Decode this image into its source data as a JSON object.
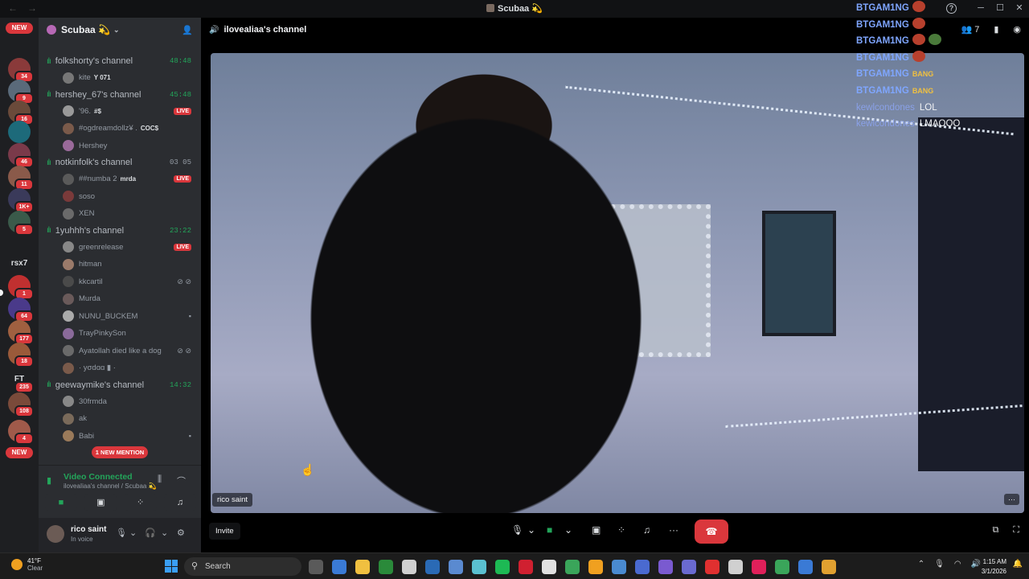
{
  "window": {
    "title": "Scubaa 💫",
    "help": "?"
  },
  "rail": {
    "new_top": "NEW",
    "new_bottom": "NEW",
    "servers": [
      {
        "badge": "34",
        "color": "#8a3a3a"
      },
      {
        "badge": "9",
        "color": "#5a6a7a"
      },
      {
        "badge": "16",
        "color": "#6a4a3a"
      },
      {
        "badge": "",
        "color": "#1d6a7a"
      },
      {
        "badge": "46",
        "color": "#7a3a4a"
      },
      {
        "badge": "11",
        "color": "#8a5a4a"
      },
      {
        "badge": "1K+",
        "color": "#3a3a5a"
      },
      {
        "badge": "5",
        "color": "#3a5a4a"
      },
      {
        "badge": "",
        "color": "",
        "text": "rsx7"
      },
      {
        "badge": "1",
        "color": "#c03030"
      },
      {
        "badge": "64",
        "color": "#4a3a8a"
      },
      {
        "badge": "177",
        "color": "#a06040"
      },
      {
        "badge": "18",
        "color": "#9a5a3a"
      },
      {
        "badge": "235",
        "color": "",
        "text": "FT"
      },
      {
        "badge": "108",
        "color": "#7a4a3a"
      },
      {
        "badge": "4",
        "color": "#a05a4a"
      }
    ]
  },
  "sidebar": {
    "guild_name": "Scubaa 💫",
    "channels": [
      {
        "name": "folkshorty's channel",
        "time": "48:48",
        "time_style": "green",
        "members": [
          {
            "name": "kite",
            "tag": "Y 071",
            "live": false,
            "icon": "",
            "color": "#777"
          }
        ]
      },
      {
        "name": "hershey_67's channel",
        "time": "45:48",
        "time_style": "green",
        "members": [
          {
            "name": "'96.",
            "tag": "#$",
            "live": true,
            "icon": "",
            "color": "#999"
          },
          {
            "name": "#ogdreamdollz¥ .",
            "tag": "COC$",
            "live": false,
            "icon": "",
            "color": "#7a5a4a"
          },
          {
            "name": "Hershey",
            "tag": "",
            "live": false,
            "icon": "",
            "color": "#9a6a9a"
          }
        ]
      },
      {
        "name": "notkinfolk's channel",
        "time": "03 05",
        "time_style": "grey",
        "members": [
          {
            "name": "##numba 2",
            "tag": "mrda",
            "live": true,
            "icon": "",
            "color": "#5a5a5a"
          },
          {
            "name": "soso",
            "tag": "",
            "live": false,
            "icon": "",
            "color": "#7a3a3a"
          },
          {
            "name": "XEN",
            "tag": "",
            "live": false,
            "icon": "",
            "color": "#6a6a6a"
          }
        ]
      },
      {
        "name": "1yuhhh's channel",
        "time": "23:22",
        "time_style": "green",
        "members": [
          {
            "name": "greenrelease",
            "tag": "",
            "live": true,
            "icon": "",
            "color": "#888"
          },
          {
            "name": "hitman",
            "tag": "",
            "live": false,
            "icon": "",
            "color": "#9a7a6a"
          },
          {
            "name": "kkcartil",
            "tag": "",
            "live": false,
            "icon": "⊘ ⊘",
            "color": "#4a4a4a"
          },
          {
            "name": "Murda",
            "tag": "",
            "live": false,
            "icon": "",
            "color": "#6a5a5a"
          },
          {
            "name": "NUNU_BUCKEM",
            "tag": "",
            "live": false,
            "icon": "▪",
            "color": "#aaa"
          },
          {
            "name": "TrayPinkySon",
            "tag": "",
            "live": false,
            "icon": "",
            "color": "#8a6a9a"
          },
          {
            "name": "Ayatollah died like a dog",
            "tag": "",
            "live": false,
            "icon": "⊘ ⊘",
            "color": "#6a6a6a"
          },
          {
            "name": "· yσdɑɑ ▮ ·",
            "tag": "",
            "live": false,
            "icon": "",
            "color": "#7a5a4a"
          }
        ]
      },
      {
        "name": "geewaymike's channel",
        "time": "14:32",
        "time_style": "green",
        "members": [
          {
            "name": "30frmda",
            "tag": "",
            "live": false,
            "icon": "",
            "color": "#888"
          },
          {
            "name": "ak",
            "tag": "",
            "live": false,
            "icon": "",
            "color": "#7a6a5a"
          },
          {
            "name": "Babi",
            "tag": "",
            "live": false,
            "icon": "▪",
            "color": "#9a7a5a"
          }
        ]
      }
    ],
    "mention_pill": "1 NEW MENTION",
    "voice": {
      "status": "Video Connected",
      "location": "iloveaIiaa's channel / Scubaa 💫"
    },
    "user": {
      "name": "rico saint",
      "status": "In voice"
    }
  },
  "main": {
    "channel_name": "iloveaIiaa's channel",
    "viewer_count": "7",
    "stream_name": "rico saint",
    "invite_label": "Invite"
  },
  "chat": [
    {
      "user": "BTGAM1NG",
      "msg": "",
      "emote": "tomato"
    },
    {
      "user": "BTGAM1NG",
      "msg": "",
      "emote": "tomato"
    },
    {
      "user": "BTGAM1NG",
      "msg": "",
      "emote": "tomato-double"
    },
    {
      "user": "BTGAM1NG",
      "msg": "",
      "emote": "tomato"
    },
    {
      "user": "BTGAM1NG",
      "msg": "",
      "emote": "BANG"
    },
    {
      "user": "BTGAM1NG",
      "msg": "",
      "emote": "BANG"
    },
    {
      "user": "kewlcondones",
      "msg": "LOL",
      "emote": ""
    },
    {
      "user": "kewlcondones",
      "msg": "LMAOOO",
      "emote": ""
    }
  ],
  "taskbar": {
    "weather_temp": "41°F",
    "weather_desc": "Clear",
    "search_label": "Search",
    "time": "1:15 AM",
    "date": "3/1/2026",
    "pinned_colors": [
      "#5a5a5a",
      "#3a7ad5",
      "#f0c040",
      "#2a8a3a",
      "#d0d0d0",
      "#2a6ab5",
      "#5a8ad0",
      "#5ac0d0",
      "#1db954",
      "#d02030",
      "#e0e0e0",
      "#3aa55a",
      "#f0a020",
      "#4a8ad0",
      "#4a6ad0",
      "#7a5ad0",
      "#6a6ad0",
      "#e03030",
      "#d0d0d0",
      "#e0205a",
      "#3aa55a",
      "#3a7ad5",
      "#e0a030"
    ]
  }
}
